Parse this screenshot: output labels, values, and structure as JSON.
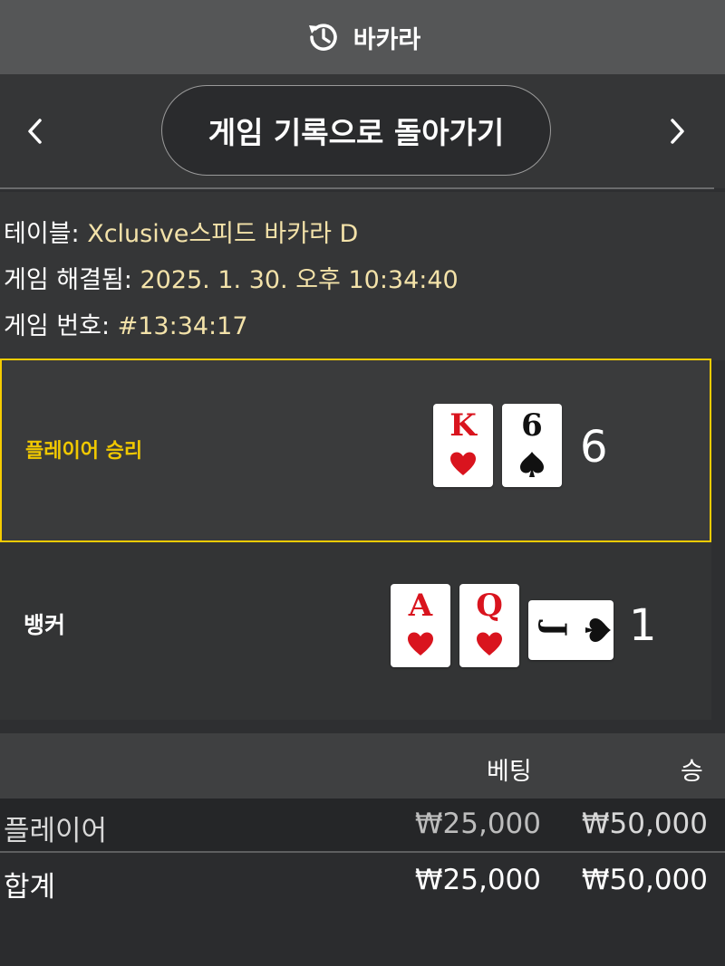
{
  "header": {
    "title": "바카라",
    "icon": "history-icon"
  },
  "nav": {
    "back_label": "게임 기록으로 돌아가기",
    "prev_icon": "chevron-left-icon",
    "next_icon": "chevron-right-icon"
  },
  "game_info": {
    "table_label": "테이블: ",
    "table_value": "Xclusive스피드 바카라 D",
    "resolved_label": "게임 해결됨: ",
    "resolved_value": "2025. 1. 30. 오후 10:34:40",
    "number_label": "게임 번호: ",
    "number_value": "#13:34:17"
  },
  "hands": {
    "player": {
      "label": "플레이어 승리",
      "score": "6",
      "cards": [
        {
          "rank": "K",
          "suit": "heart"
        },
        {
          "rank": "6",
          "suit": "spade"
        }
      ]
    },
    "banker": {
      "label": "뱅커",
      "score": "1",
      "cards": [
        {
          "rank": "A",
          "suit": "heart"
        },
        {
          "rank": "Q",
          "suit": "heart"
        },
        {
          "rank": "J",
          "suit": "spade"
        }
      ]
    }
  },
  "bets": {
    "columns": {
      "bet": "베팅",
      "win": "승"
    },
    "rows": [
      {
        "name": "플레이어",
        "bet": "₩25,000",
        "win": "₩50,000"
      }
    ],
    "total": {
      "name": "합계",
      "bet": "₩25,000",
      "win": "₩50,000"
    }
  },
  "colors": {
    "accent": "#f5cc00",
    "info_value": "#f3e2a9",
    "card_red": "#d9141e"
  }
}
